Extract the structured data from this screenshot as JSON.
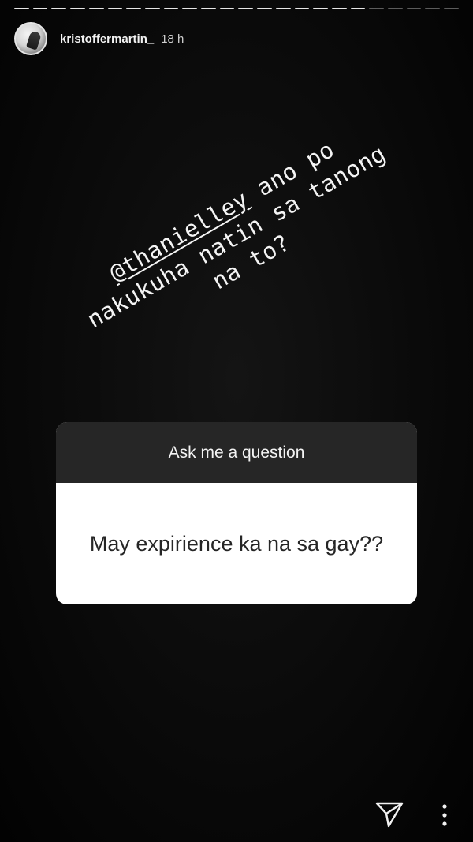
{
  "story": {
    "progress_segments": 24,
    "progress_viewed": 19,
    "user": {
      "username": "kristoffermartin_",
      "time_ago": "18 h"
    },
    "caption": {
      "mention": "@thanielley",
      "line1_rest": " ano po",
      "line2": "nakukuha natin sa tanong",
      "line3": "na to?"
    },
    "question_sticker": {
      "prompt": "Ask me a question",
      "question": "May expirience ka na sa gay??"
    },
    "footer": {
      "send_icon": "paper-plane-icon",
      "more_icon": "more-vertical-icon"
    },
    "colors": {
      "background": "#000000",
      "sticker_header": "#262626",
      "sticker_body": "#ffffff"
    }
  }
}
